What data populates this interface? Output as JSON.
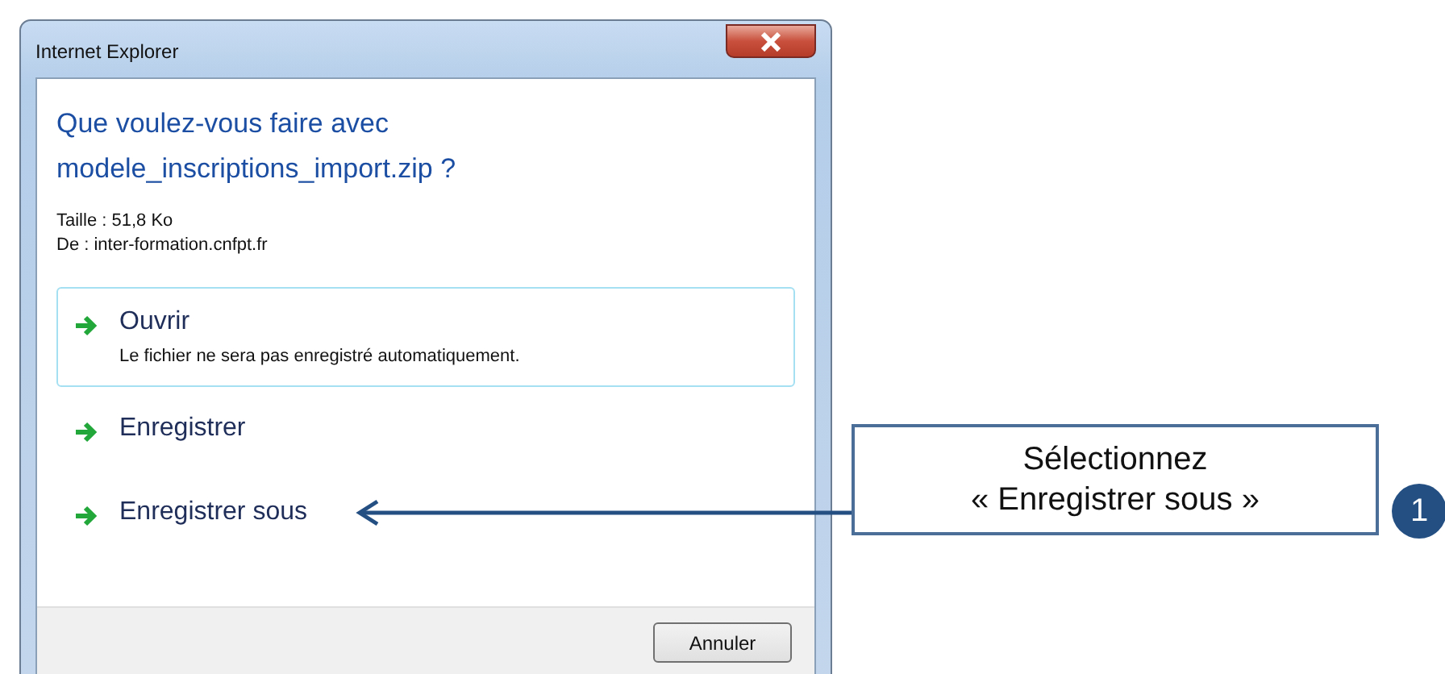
{
  "window": {
    "title": "Internet Explorer"
  },
  "question": "Que voulez-vous faire avec modele_inscriptions_import.zip ?",
  "details": [
    "Taille : 51,8 Ko",
    "De : inter-formation.cnfpt.fr"
  ],
  "options": [
    {
      "label": "Ouvrir",
      "description": "Le fichier ne sera pas enregistré automatiquement.",
      "selected": true
    },
    {
      "label": "Enregistrer",
      "selected": false
    },
    {
      "label": "Enregistrer sous",
      "selected": false
    }
  ],
  "buttons": [
    "Annuler"
  ],
  "callout": {
    "lines": [
      "Sélectionnez",
      "« Enregistrer sous »"
    ],
    "badge": "1"
  }
}
